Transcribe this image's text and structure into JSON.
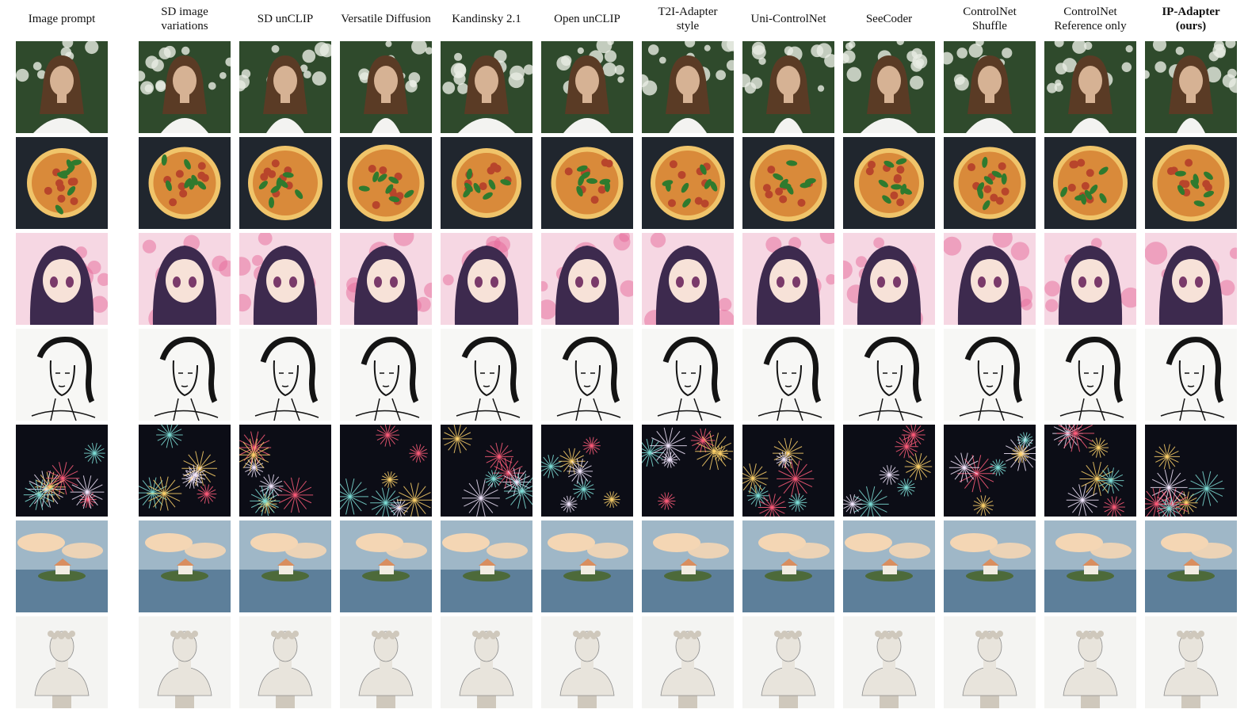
{
  "columns": [
    {
      "id": "prompt",
      "label": "Image prompt",
      "bold": false
    },
    {
      "id": "sd_variations",
      "label": "SD image\nvariations",
      "bold": false
    },
    {
      "id": "sd_unclip",
      "label": "SD unCLIP",
      "bold": false
    },
    {
      "id": "versatile",
      "label": "Versatile Diffusion",
      "bold": false
    },
    {
      "id": "kandinsky",
      "label": "Kandinsky 2.1",
      "bold": false
    },
    {
      "id": "open_unclip",
      "label": "Open unCLIP",
      "bold": false
    },
    {
      "id": "t2i",
      "label": "T2I-Adapter\nstyle",
      "bold": false
    },
    {
      "id": "uni",
      "label": "Uni-ControlNet",
      "bold": false
    },
    {
      "id": "seecoder",
      "label": "SeeCoder",
      "bold": false
    },
    {
      "id": "cn_shuffle",
      "label": "ControlNet\nShuffle",
      "bold": false
    },
    {
      "id": "cn_ref",
      "label": "ControlNet\nReference only",
      "bold": false
    },
    {
      "id": "ip_adapter",
      "label": "IP-Adapter\n(ours)",
      "bold": true
    }
  ],
  "rows": [
    {
      "id": "portrait",
      "subject": "woman-portrait-in-flowers",
      "colors": {
        "bg": "#2f4a2c",
        "accent": "#e9ece4",
        "figure": "#d6b294",
        "hair": "#5a3b25",
        "shirt": "#f3f3f1"
      }
    },
    {
      "id": "pizza",
      "subject": "pizza-top-view",
      "colors": {
        "bg": "#20262e",
        "accent": "#2f7a2e",
        "figure": "#d98a3a",
        "hair": "#b8452b",
        "shirt": "#f0c46a"
      }
    },
    {
      "id": "anime",
      "subject": "anime-girl",
      "colors": {
        "bg": "#f6d7e3",
        "accent": "#e66a9a",
        "figure": "#f7e2d8",
        "hair": "#3d2a4e",
        "shirt": "#ffffff"
      }
    },
    {
      "id": "sketch",
      "subject": "ink-sketch-woman",
      "colors": {
        "bg": "#f7f7f5",
        "accent": "#cfcfcf",
        "figure": "#fafafa",
        "hair": "#141414",
        "shirt": "#ffffff"
      }
    },
    {
      "id": "fireworks",
      "subject": "fireworks-night",
      "colors": {
        "bg": "#0c0d16",
        "accent": "#ff5c7a",
        "figure": "#7fe0d8",
        "hair": "#f4e8ff",
        "shirt": "#ffd36b"
      }
    },
    {
      "id": "landscape",
      "subject": "house-on-island",
      "colors": {
        "bg": "#9fb7c7",
        "accent": "#f4d6b4",
        "figure": "#5d7f9a",
        "hair": "#4d6a3a",
        "shirt": "#d98e5f"
      }
    },
    {
      "id": "bust",
      "subject": "marble-bust",
      "colors": {
        "bg": "#f4f4f2",
        "accent": "#8c8c8c",
        "figure": "#e8e4dc",
        "hair": "#cfc8bc",
        "shirt": "#b5aea2"
      }
    }
  ]
}
